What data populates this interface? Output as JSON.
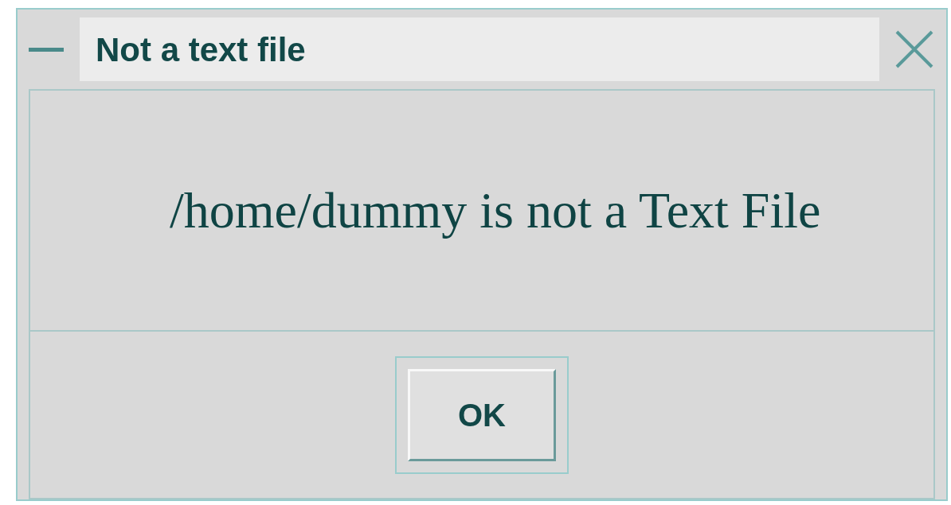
{
  "window": {
    "title": "Not a text file"
  },
  "message": "/home/dummy is not a Text File",
  "buttons": [
    "OK"
  ]
}
